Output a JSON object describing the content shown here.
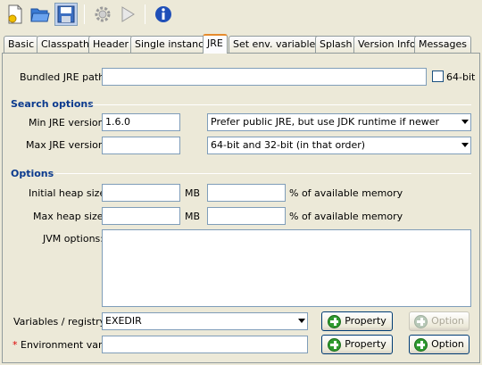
{
  "toolbar": {
    "icons": [
      "new-document-icon",
      "open-folder-icon",
      "save-icon",
      "settings-gear-icon",
      "run-icon",
      "info-icon"
    ],
    "colors": {
      "folder": "#3a7bd5",
      "save_bg": "#c1d2ee",
      "info": "#1f4fb8"
    }
  },
  "tabs": [
    "Basic",
    "Classpath",
    "Header",
    "Single instance",
    "JRE",
    "Set env. variables",
    "Splash",
    "Version Info",
    "Messages"
  ],
  "active_tab": "JRE",
  "jre": {
    "bundled_path_label": "Bundled JRE path:",
    "bundled_path_value": "",
    "bit64_label": "64-bit",
    "bit64_checked": false
  },
  "search": {
    "title": "Search options",
    "min_label": "Min JRE version:",
    "min_value": "1.6.0",
    "max_label": "Max JRE version:",
    "max_value": "",
    "jdk_pref": "Prefer public JRE, but use JDK runtime if newer",
    "arch_pref": "64-bit and 32-bit (in that order)"
  },
  "options": {
    "title": "Options",
    "initial_heap_label": "Initial heap size:",
    "max_heap_label": "Max heap size:",
    "mb_label": "MB",
    "pct_label": "% of available memory",
    "jvm_options_label": "JVM options:",
    "vars_label": "Variables / registry:",
    "vars_value": "EXEDIR",
    "property_label": "Property",
    "option_label": "Option",
    "env_var_required": "*",
    "env_var_label": "Environment var:"
  }
}
